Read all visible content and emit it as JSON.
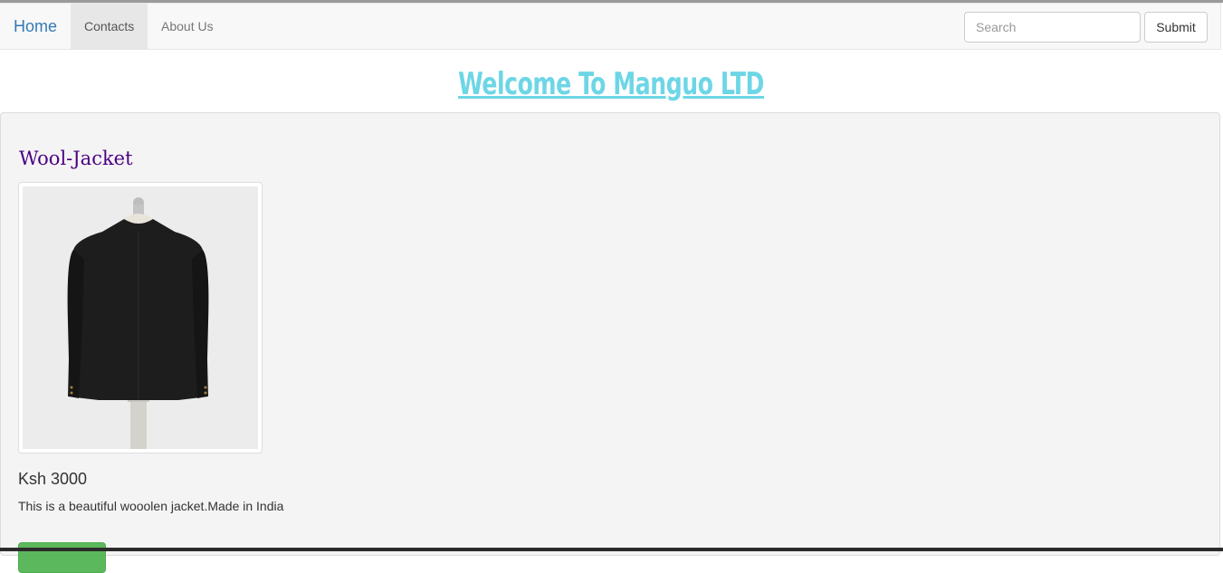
{
  "navbar": {
    "brand": "Home",
    "items": [
      {
        "label": "Contacts"
      },
      {
        "label": "About Us"
      }
    ],
    "search": {
      "placeholder": "Search",
      "value": ""
    },
    "submit_label": "Submit"
  },
  "header": {
    "title": "Welcome To Manguo LTD",
    "color": "#6dd6e6"
  },
  "product": {
    "name": "Wool-Jacket",
    "price": "Ksh 3000",
    "description": "This is a beautiful wooolen jacket.Made in India",
    "image": "jacket-on-mannequin",
    "buy_button_color": "#5cb85c"
  }
}
